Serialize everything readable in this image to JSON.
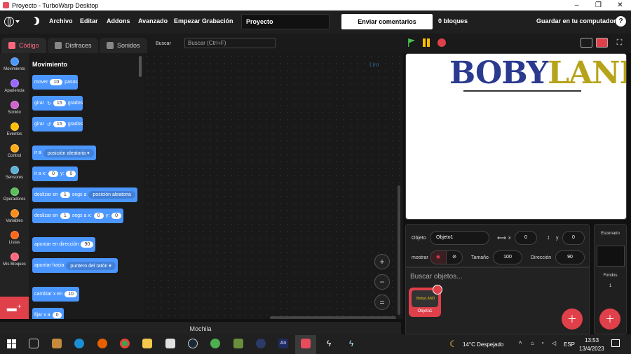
{
  "window": {
    "title": "Proyecto - TurboWarp Desktop",
    "buttons": [
      "–",
      "❐",
      "✕"
    ]
  },
  "menu": {
    "items": [
      "Archivo",
      "Editar",
      "Addons",
      "Avanzado",
      "Empezar Grabación"
    ],
    "project_title": "Proyecto",
    "feedback": "Enviar comentarios (feedback)",
    "blocks_count": "0 bloques",
    "save": "Guardar en tu computador",
    "help": "?"
  },
  "tabs": {
    "code": "Código",
    "costumes": "Disfraces",
    "sounds": "Sonidos"
  },
  "search": {
    "label": "Buscar",
    "placeholder": "Buscar (Ctrl+F)"
  },
  "categories": [
    {
      "label": "Movimiento",
      "color": "#4c97ff"
    },
    {
      "label": "Apariencia",
      "color": "#9966ff"
    },
    {
      "label": "Sonido",
      "color": "#cf63cf"
    },
    {
      "label": "Eventos",
      "color": "#ffbf00"
    },
    {
      "label": "Control",
      "color": "#ffab19"
    },
    {
      "label": "Sensores",
      "color": "#5cb1d6"
    },
    {
      "label": "Operadores",
      "color": "#59c059"
    },
    {
      "label": "Variables",
      "color": "#ff8c1a"
    },
    {
      "label": "Listas",
      "color": "#ff661a"
    },
    {
      "label": "Mis Bloques",
      "color": "#ff6680"
    }
  ],
  "palette": {
    "title": "Movimiento",
    "blocks": {
      "move": {
        "pre": "mover",
        "val": "10",
        "post": "pasos"
      },
      "turn_right": {
        "pre": "girar",
        "icon": "↻",
        "val": "15",
        "post": "grados"
      },
      "turn_left": {
        "pre": "girar",
        "icon": "↺",
        "val": "15",
        "post": "grados"
      },
      "goto": {
        "pre": "ir a",
        "dd": "posición aleatoria"
      },
      "goto_xy": {
        "pre": "ir a x:",
        "x": "0",
        "y_label": "y:",
        "y": "0"
      },
      "glide_to": {
        "pre": "deslizar en",
        "val": "1",
        "mid": "segs a",
        "dd": "posición aleatoria"
      },
      "glide_xy": {
        "pre": "deslizar en",
        "val": "1",
        "mid": "segs a x:",
        "x": "0",
        "y_label": "y:",
        "y": "0"
      },
      "point_dir": {
        "pre": "apuntar en dirección",
        "val": "90"
      },
      "point_towards": {
        "pre": "apuntar hacia",
        "dd": "puntero del ratón"
      },
      "change_x": {
        "pre": "cambiar x en",
        "val": "10"
      },
      "set_x": {
        "pre": "fijar x a",
        "val": "0"
      }
    }
  },
  "workspace": {
    "logo": "Liro",
    "zoom": [
      "+",
      "−",
      "="
    ]
  },
  "backpack": "Mochila",
  "stage": {
    "logo_a": "BOBY",
    "logo_b": "LAND"
  },
  "sprite_info": {
    "object_label": "Objeto",
    "object_name": "Objeto1",
    "x_label": "x",
    "x": "0",
    "y_label": "y",
    "y": "0",
    "show_label": "mostrar",
    "size_label": "Tamaño",
    "size": "100",
    "dir_label": "Dirección",
    "dir": "90"
  },
  "sprites": {
    "search": "Buscar objetos...",
    "items": [
      {
        "name": "Objeto1",
        "thumb": "BobyLAND"
      }
    ]
  },
  "stage_panel": {
    "title": "Escenario",
    "backdrops_label": "Fondos",
    "backdrops": "1"
  },
  "taskbar": {
    "weather": "14°C Despejado",
    "lang": "ESP",
    "time": "13:53",
    "date": "13/4/2023",
    "an_label": "An"
  }
}
